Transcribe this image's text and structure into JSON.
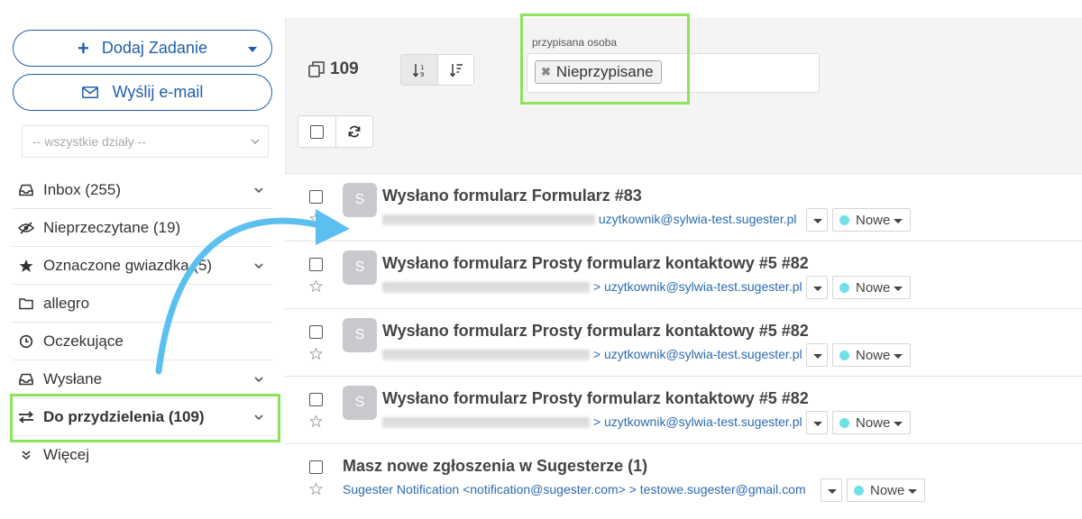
{
  "sidebar": {
    "add_task_label": "Dodaj Zadanie",
    "send_email_label": "Wyślij e-mail",
    "department_select": "-- wszystkie działy --",
    "items": [
      {
        "label": "Inbox (255)"
      },
      {
        "label": "Nieprzeczytane (19)"
      },
      {
        "label": "Oznaczone gwiazdką (5)"
      },
      {
        "label": "allegro"
      },
      {
        "label": "Oczekujące"
      },
      {
        "label": "Wysłane"
      },
      {
        "label": "Do przydzielenia (109)"
      },
      {
        "label": "Więcej"
      }
    ]
  },
  "toolbar": {
    "count": "109",
    "filter_label": "przypisana osoba",
    "filter_tag": "Nieprzypisane"
  },
  "messages": [
    {
      "avatar": "S",
      "subject": "Wysłano formularz Formularz #83",
      "recipient": "uzytkownik@sylwia-test.sugester.pl",
      "status": "Nowe"
    },
    {
      "avatar": "S",
      "subject": "Wysłano formularz Prosty formularz kontaktowy #5 #82",
      "recipient": "uzytkownik@sylwia-test.sugester.pl",
      "status": "Nowe"
    },
    {
      "avatar": "S",
      "subject": "Wysłano formularz Prosty formularz kontaktowy #5 #82",
      "recipient": "uzytkownik@sylwia-test.sugester.pl",
      "status": "Nowe"
    },
    {
      "avatar": "S",
      "subject": "Wysłano formularz Prosty formularz kontaktowy #5 #82",
      "recipient": "uzytkownik@sylwia-test.sugester.pl",
      "status": "Nowe"
    },
    {
      "subject": "Masz nowe zgłoszenia w Sugesterze (1)",
      "sender": "Sugester Notification <notification@sugester.com> > testowe.sugester@gmail.com",
      "status": "Nowe"
    }
  ],
  "colors": {
    "accent": "#1f5fa8",
    "highlight": "#8de35c",
    "arrow": "#5bc0f0",
    "status_dot": "#6fe0e8"
  }
}
